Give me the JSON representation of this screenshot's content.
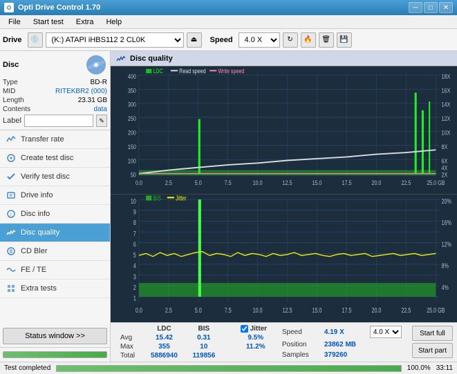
{
  "titlebar": {
    "title": "Opti Drive Control 1.70",
    "min_btn": "─",
    "max_btn": "□",
    "close_btn": "✕"
  },
  "menubar": {
    "items": [
      "File",
      "Start test",
      "Extra",
      "Help"
    ]
  },
  "toolbar": {
    "drive_label": "Drive",
    "drive_value": "(K:)  ATAPI iHBS112  2 CL0K",
    "speed_label": "Speed",
    "speed_value": "4.0 X"
  },
  "disc_panel": {
    "title": "Disc",
    "type_label": "Type",
    "type_value": "BD-R",
    "mid_label": "MID",
    "mid_value": "RITEKBR2 (000)",
    "length_label": "Length",
    "length_value": "23.31 GB",
    "contents_label": "Contents",
    "contents_value": "data",
    "label_label": "Label",
    "label_value": ""
  },
  "nav": {
    "items": [
      {
        "id": "transfer-rate",
        "label": "Transfer rate",
        "icon": "chart"
      },
      {
        "id": "create-test-disc",
        "label": "Create test disc",
        "icon": "disc"
      },
      {
        "id": "verify-test-disc",
        "label": "Verify test disc",
        "icon": "check"
      },
      {
        "id": "drive-info",
        "label": "Drive info",
        "icon": "info"
      },
      {
        "id": "disc-info",
        "label": "Disc info",
        "icon": "disc2"
      },
      {
        "id": "disc-quality",
        "label": "Disc quality",
        "icon": "quality",
        "active": true
      },
      {
        "id": "cd-bler",
        "label": "CD Bler",
        "icon": "cd"
      },
      {
        "id": "fe-te",
        "label": "FE / TE",
        "icon": "wave"
      },
      {
        "id": "extra-tests",
        "label": "Extra tests",
        "icon": "extra"
      }
    ],
    "status_window_btn": "Status window >>"
  },
  "disc_quality": {
    "title": "Disc quality",
    "chart_top": {
      "legend": [
        "LDC",
        "Read speed",
        "Write speed"
      ],
      "y_max": 400,
      "y_labels": [
        "400",
        "350",
        "300",
        "250",
        "200",
        "150",
        "100",
        "50"
      ],
      "y_right": [
        "18X",
        "16X",
        "14X",
        "12X",
        "10X",
        "8X",
        "6X",
        "4X",
        "2X"
      ],
      "x_labels": [
        "0.0",
        "2.5",
        "5.0",
        "7.5",
        "10.0",
        "12.5",
        "15.0",
        "17.5",
        "20.0",
        "22.5",
        "25.0 GB"
      ]
    },
    "chart_bottom": {
      "legend": [
        "BIS",
        "Jitter"
      ],
      "y_max": 10,
      "y_labels": [
        "10",
        "9",
        "8",
        "7",
        "6",
        "5",
        "4",
        "3",
        "2",
        "1"
      ],
      "y_right": [
        "20%",
        "16%",
        "12%",
        "8%",
        "4%"
      ],
      "x_labels": [
        "0.0",
        "2.5",
        "5.0",
        "7.5",
        "10.0",
        "12.5",
        "15.0",
        "17.5",
        "20.0",
        "22.5",
        "25.0 GB"
      ]
    }
  },
  "stats": {
    "headers": [
      "LDC",
      "BIS",
      "",
      "Jitter",
      "Speed",
      "4.19 X",
      ""
    ],
    "avg_label": "Avg",
    "avg_ldc": "15.42",
    "avg_bis": "0.31",
    "avg_jitter": "9.5%",
    "max_label": "Max",
    "max_ldc": "355",
    "max_bis": "10",
    "max_jitter": "11.2%",
    "total_label": "Total",
    "total_ldc": "5886940",
    "total_bis": "119856",
    "position_label": "Position",
    "position_value": "23862 MB",
    "samples_label": "Samples",
    "samples_value": "379260",
    "speed_label": "Speed",
    "speed_display": "4.19 X",
    "speed_select": "4.0 X",
    "jitter_checked": true,
    "jitter_label": "Jitter",
    "start_full_btn": "Start full",
    "start_part_btn": "Start part"
  },
  "bottom_bar": {
    "status_text": "Test completed",
    "progress_pct": 100,
    "time": "33:11"
  }
}
